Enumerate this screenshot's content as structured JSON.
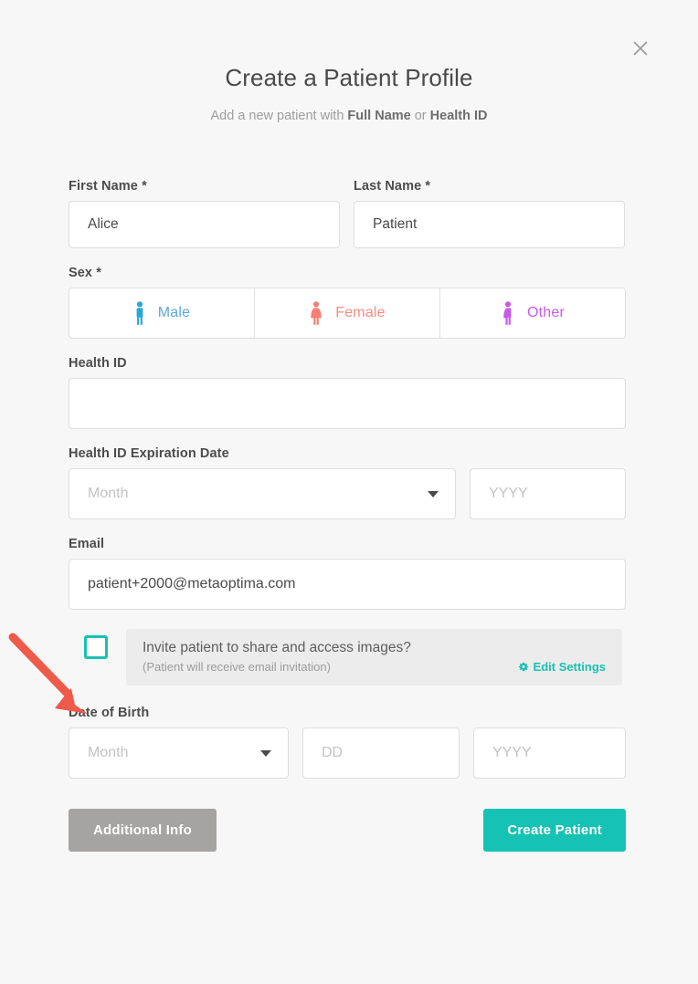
{
  "dialog": {
    "title": "Create a Patient Profile",
    "subtitle": {
      "prefix": "Add a new patient with ",
      "bold1": "Full Name",
      "middle": " or ",
      "bold2": "Health ID"
    },
    "close_icon": "close-icon"
  },
  "form": {
    "first_name": {
      "label": "First Name *",
      "value": "Alice",
      "placeholder": ""
    },
    "last_name": {
      "label": "Last Name *",
      "value": "Patient",
      "placeholder": ""
    },
    "sex": {
      "label": "Sex *",
      "options": [
        {
          "label": "Male",
          "icon": "male-figure-icon",
          "color": "#29a8d8"
        },
        {
          "label": "Female",
          "icon": "female-figure-icon",
          "color": "#f97d73"
        },
        {
          "label": "Other",
          "icon": "other-figure-icon",
          "color": "#c75ae8"
        }
      ]
    },
    "health_id": {
      "label": "Health ID",
      "value": "",
      "placeholder": ""
    },
    "health_id_expiration": {
      "label": "Health ID Expiration Date",
      "month_placeholder": "Month",
      "month_value": "",
      "year_placeholder": "YYYY",
      "year_value": ""
    },
    "email": {
      "label": "Email",
      "value": "patient+2000@metaoptima.com",
      "placeholder": ""
    },
    "invite": {
      "checked": false,
      "title": "Invite patient to share and access images?",
      "subtitle": "(Patient will receive email invitation)",
      "edit_settings_label": "Edit Settings",
      "gear_icon": "gear-icon"
    },
    "date_of_birth": {
      "label": "Date of Birth",
      "month_placeholder": "Month",
      "month_value": "",
      "day_placeholder": "DD",
      "day_value": "",
      "year_placeholder": "YYYY",
      "year_value": ""
    }
  },
  "actions": {
    "additional_info_label": "Additional Info",
    "create_patient_label": "Create Patient"
  },
  "colors": {
    "accent_teal": "#16c2b4",
    "secondary_gray": "#a6a3a3",
    "annotation_red": "#ef5a4a",
    "dialog_bg": "#f7f7f7",
    "invite_bg": "#ececec"
  },
  "annotation": {
    "arrow_icon": "red-arrow-pointer",
    "points_to": "invite-patient-checkbox"
  }
}
